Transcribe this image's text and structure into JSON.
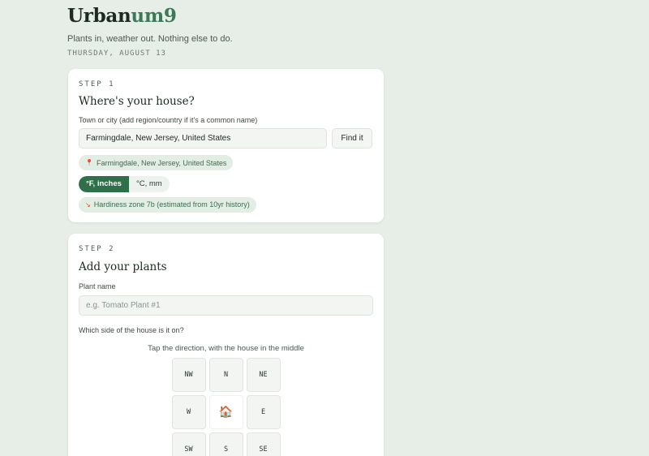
{
  "app": {
    "brand_prefix": "Urban",
    "brand_accent": "um9",
    "tagline": "Plants in, weather out. Nothing else to do.",
    "date": "THURSDAY, AUGUST 13"
  },
  "colors": {
    "background": "#e6eee7",
    "accent": "#3b7a56",
    "toggle_active": "#2f6f4a",
    "pill_bg": "#e2ede4"
  },
  "step1": {
    "step_label": "STEP 1",
    "title": "Where's your house?",
    "location_label": "Town or city (add region/country if it's a common name)",
    "location_value": "Farmingdale, New Jersey, United States",
    "find_button": "Find it",
    "resolved_location": "Farmingdale, New Jersey, United States",
    "resolved_icon": "pin-icon",
    "units": [
      "°F, inches",
      "°C, mm"
    ],
    "units_selected": "°F, inches",
    "hardiness": "Hardiness zone 7b (estimated from 10yr history)",
    "hardiness_icon": "sprout-icon"
  },
  "step2": {
    "step_label": "STEP 2",
    "title": "Add your plants",
    "plant_name_label": "Plant name",
    "plant_name_placeholder": "e.g. Tomato Plant #1",
    "side_label": "Which side of the house is it on?",
    "compass_hint": "Tap the direction, with the house in the middle",
    "directions": {
      "nw": "NW",
      "n": "N",
      "ne": "NE",
      "w": "W",
      "center": "🏠",
      "e": "E",
      "sw": "SW",
      "s": "S",
      "se": "SE"
    }
  }
}
